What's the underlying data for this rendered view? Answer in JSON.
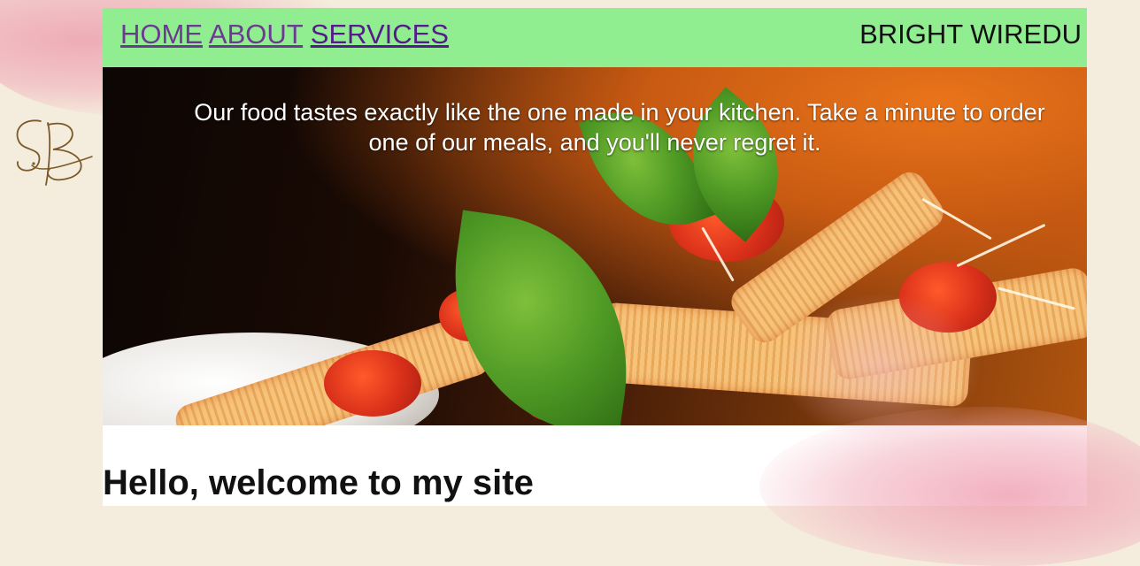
{
  "nav": {
    "links": [
      {
        "label": "HOME"
      },
      {
        "label": "ABOUT"
      },
      {
        "label": "SERVICES"
      }
    ],
    "brand": "BRIGHT WIREDU"
  },
  "hero": {
    "text_line1": "Our food tastes exactly like the one made in your kitchen. Take a minute to order",
    "text_line2": "one of our meals, and you'll never regret it."
  },
  "main": {
    "heading": "Hello, welcome to my site"
  },
  "colors": {
    "background": "#f4ecdc",
    "nav_bar": "#90ee90",
    "link": "#551a8b",
    "hero_text": "#ffffff"
  }
}
